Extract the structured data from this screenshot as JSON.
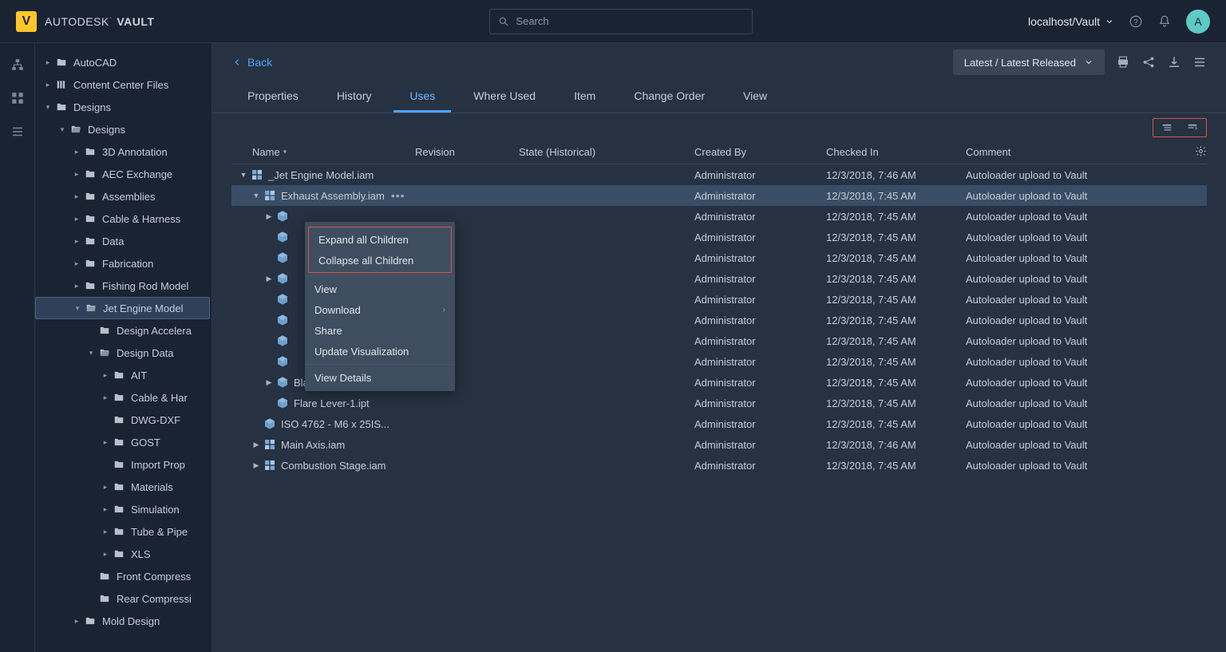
{
  "header": {
    "logo_letter": "V",
    "brand_prefix": "AUTODESK",
    "brand_suffix": "VAULT",
    "search_placeholder": "Search",
    "server": "localhost/Vault",
    "avatar_letter": "A"
  },
  "sidebar": {
    "items": [
      {
        "label": "AutoCAD",
        "indent": 0,
        "caret": "right",
        "icon": "folder"
      },
      {
        "label": "Content Center Files",
        "indent": 0,
        "caret": "right",
        "icon": "library"
      },
      {
        "label": "Designs",
        "indent": 0,
        "caret": "down",
        "icon": "folder"
      },
      {
        "label": "Designs",
        "indent": 1,
        "caret": "down",
        "icon": "folder-open"
      },
      {
        "label": "3D Annotation",
        "indent": 2,
        "caret": "right",
        "icon": "folder"
      },
      {
        "label": "AEC Exchange",
        "indent": 2,
        "caret": "right",
        "icon": "folder"
      },
      {
        "label": "Assemblies",
        "indent": 2,
        "caret": "right",
        "icon": "folder"
      },
      {
        "label": "Cable & Harness",
        "indent": 2,
        "caret": "right",
        "icon": "folder"
      },
      {
        "label": "Data",
        "indent": 2,
        "caret": "right",
        "icon": "folder"
      },
      {
        "label": "Fabrication",
        "indent": 2,
        "caret": "right",
        "icon": "folder"
      },
      {
        "label": "Fishing Rod Model",
        "indent": 2,
        "caret": "right",
        "icon": "folder"
      },
      {
        "label": "Jet Engine Model",
        "indent": 2,
        "caret": "down",
        "icon": "folder-open",
        "selected": true
      },
      {
        "label": "Design Accelera",
        "indent": 3,
        "caret": "",
        "icon": "folder"
      },
      {
        "label": "Design Data",
        "indent": 3,
        "caret": "down",
        "icon": "folder-open"
      },
      {
        "label": "AIT",
        "indent": 4,
        "caret": "right",
        "icon": "folder"
      },
      {
        "label": "Cable & Har",
        "indent": 4,
        "caret": "right",
        "icon": "folder"
      },
      {
        "label": "DWG-DXF",
        "indent": 4,
        "caret": "",
        "icon": "folder"
      },
      {
        "label": "GOST",
        "indent": 4,
        "caret": "right",
        "icon": "folder"
      },
      {
        "label": "Import Prop",
        "indent": 4,
        "caret": "",
        "icon": "folder"
      },
      {
        "label": "Materials",
        "indent": 4,
        "caret": "right",
        "icon": "folder"
      },
      {
        "label": "Simulation",
        "indent": 4,
        "caret": "right",
        "icon": "folder"
      },
      {
        "label": "Tube & Pipe",
        "indent": 4,
        "caret": "right",
        "icon": "folder"
      },
      {
        "label": "XLS",
        "indent": 4,
        "caret": "right",
        "icon": "folder"
      },
      {
        "label": "Front Compress",
        "indent": 3,
        "caret": "",
        "icon": "folder"
      },
      {
        "label": "Rear Compressi",
        "indent": 3,
        "caret": "",
        "icon": "folder"
      },
      {
        "label": "Mold Design",
        "indent": 2,
        "caret": "right",
        "icon": "folder"
      }
    ]
  },
  "main": {
    "back_label": "Back",
    "version_dropdown": "Latest / Latest Released",
    "tabs": [
      "Properties",
      "History",
      "Uses",
      "Where Used",
      "Item",
      "Change Order",
      "View"
    ],
    "active_tab": 2,
    "columns": {
      "name": "Name",
      "revision": "Revision",
      "state": "State (Historical)",
      "created_by": "Created By",
      "checked_in": "Checked In",
      "comment": "Comment"
    },
    "rows": [
      {
        "indent": 0,
        "caret": "down",
        "icon": "asm",
        "name": "_Jet Engine Model.iam",
        "created": "Administrator",
        "checked": "12/3/2018, 7:46 AM",
        "comment": "Autoloader upload to Vault"
      },
      {
        "indent": 1,
        "caret": "down",
        "icon": "asm",
        "name": "Exhaust Assembly.iam",
        "created": "Administrator",
        "checked": "12/3/2018, 7:45 AM",
        "comment": "Autoloader upload to Vault",
        "selected": true,
        "ellipsis": true
      },
      {
        "indent": 2,
        "caret": "right",
        "icon": "part",
        "name": "",
        "created": "Administrator",
        "checked": "12/3/2018, 7:45 AM",
        "comment": "Autoloader upload to Vault"
      },
      {
        "indent": 2,
        "caret": "",
        "icon": "part",
        "name": "",
        "created": "Administrator",
        "checked": "12/3/2018, 7:45 AM",
        "comment": "Autoloader upload to Vault"
      },
      {
        "indent": 2,
        "caret": "",
        "icon": "part",
        "name": "",
        "created": "Administrator",
        "checked": "12/3/2018, 7:45 AM",
        "comment": "Autoloader upload to Vault"
      },
      {
        "indent": 2,
        "caret": "right",
        "icon": "part",
        "name": "",
        "created": "Administrator",
        "checked": "12/3/2018, 7:45 AM",
        "comment": "Autoloader upload to Vault"
      },
      {
        "indent": 2,
        "caret": "",
        "icon": "part",
        "name": "",
        "created": "Administrator",
        "checked": "12/3/2018, 7:45 AM",
        "comment": "Autoloader upload to Vault"
      },
      {
        "indent": 2,
        "caret": "",
        "icon": "part",
        "name": "",
        "created": "Administrator",
        "checked": "12/3/2018, 7:45 AM",
        "comment": "Autoloader upload to Vault"
      },
      {
        "indent": 2,
        "caret": "",
        "icon": "part",
        "name": "",
        "created": "Administrator",
        "checked": "12/3/2018, 7:45 AM",
        "comment": "Autoloader upload to Vault"
      },
      {
        "indent": 2,
        "caret": "",
        "icon": "part",
        "name": "",
        "created": "Administrator",
        "checked": "12/3/2018, 7:45 AM",
        "comment": "Autoloader upload to Vault"
      },
      {
        "indent": 2,
        "caret": "right",
        "icon": "part",
        "name": "Blade-2.ipt",
        "created": "Administrator",
        "checked": "12/3/2018, 7:45 AM",
        "comment": "Autoloader upload to Vault"
      },
      {
        "indent": 2,
        "caret": "",
        "icon": "part",
        "name": "Flare Lever-1.ipt",
        "created": "Administrator",
        "checked": "12/3/2018, 7:45 AM",
        "comment": "Autoloader upload to Vault"
      },
      {
        "indent": 1,
        "caret": "",
        "icon": "part",
        "name": "ISO 4762 - M6 x 25IS...",
        "created": "Administrator",
        "checked": "12/3/2018, 7:45 AM",
        "comment": "Autoloader upload to Vault"
      },
      {
        "indent": 1,
        "caret": "right",
        "icon": "asm",
        "name": "Main Axis.iam",
        "created": "Administrator",
        "checked": "12/3/2018, 7:46 AM",
        "comment": "Autoloader upload to Vault"
      },
      {
        "indent": 1,
        "caret": "right",
        "icon": "asm",
        "name": "Combustion Stage.iam",
        "created": "Administrator",
        "checked": "12/3/2018, 7:45 AM",
        "comment": "Autoloader upload to Vault"
      }
    ]
  },
  "context_menu": {
    "expand": "Expand all Children",
    "collapse": "Collapse all Children",
    "view": "View",
    "download": "Download",
    "share": "Share",
    "update_viz": "Update Visualization",
    "view_details": "View Details"
  }
}
